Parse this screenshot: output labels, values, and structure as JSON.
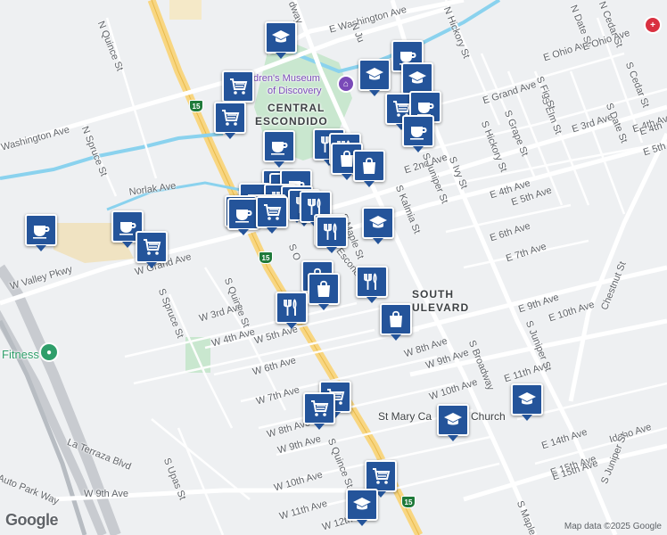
{
  "map": {
    "areas": [
      {
        "name": "central_escondido_1",
        "text": "CENTRAL"
      },
      {
        "name": "central_escondido_2",
        "text": "ESCONDIDO"
      },
      {
        "name": "south_boulevard_1",
        "text": "SOUTH"
      },
      {
        "name": "south_boulevard_2",
        "text": "ULEVARD"
      }
    ],
    "streets": [
      {
        "text": "E Washington Ave"
      },
      {
        "text": "N Quince St"
      },
      {
        "text": "N Spruce St"
      },
      {
        "text": "Washington Ave"
      },
      {
        "text": "Norlak Ave"
      },
      {
        "text": "W Valley Pkwy"
      },
      {
        "text": "W Grand Ave"
      },
      {
        "text": "S Spruce St"
      },
      {
        "text": "S Quince St"
      },
      {
        "text": "W 3rd Ave"
      },
      {
        "text": "W 4th Ave"
      },
      {
        "text": "W 5th Ave"
      },
      {
        "text": "W 6th Ave"
      },
      {
        "text": "W 7th Ave"
      },
      {
        "text": "W 8th Ave"
      },
      {
        "text": "W 9th Ave"
      },
      {
        "text": "W 10th Ave"
      },
      {
        "text": "W 11th Ave"
      },
      {
        "text": "W 12th"
      },
      {
        "text": "La Terraza Blvd"
      },
      {
        "text": "Auto Park Way"
      },
      {
        "text": "S Upas St"
      },
      {
        "text": "S Quince St"
      },
      {
        "text": "W 9th Ave"
      },
      {
        "text": "E 2nd Ave"
      },
      {
        "text": "E Grand Ave"
      },
      {
        "text": "E 3rd Ave"
      },
      {
        "text": "E 4th Ave"
      },
      {
        "text": "E 5th Ave"
      },
      {
        "text": "E 6th Ave"
      },
      {
        "text": "E 7th Ave"
      },
      {
        "text": "E 9th Ave"
      },
      {
        "text": "E 10th Ave"
      },
      {
        "text": "E 11th Ave"
      },
      {
        "text": "E 14th Ave"
      },
      {
        "text": "E 15th Ave"
      },
      {
        "text": "W 8th Ave"
      },
      {
        "text": "W 9th Ave"
      },
      {
        "text": "W 10th Ave"
      },
      {
        "text": "Idaho Ave"
      },
      {
        "text": "E Ohio Ave"
      },
      {
        "text": "S Juniper St"
      },
      {
        "text": "S Kalmia St"
      },
      {
        "text": "S Maple St"
      },
      {
        "text": "S Ivy St"
      },
      {
        "text": "S Hickory St"
      },
      {
        "text": "S Grape St"
      },
      {
        "text": "S Elm St"
      },
      {
        "text": "S Fig St"
      },
      {
        "text": "S Date St"
      },
      {
        "text": "S Cedar St"
      },
      {
        "text": "N Date St"
      },
      {
        "text": "N Cedar St"
      },
      {
        "text": "N Hickory St"
      },
      {
        "text": "Chestnut St"
      },
      {
        "text": "S Broadway"
      },
      {
        "text": "S Juniper St"
      },
      {
        "text": "E 4th Ave"
      },
      {
        "text": "E 5th Ave"
      },
      {
        "text": "S Maple"
      },
      {
        "text": "Escondido B"
      },
      {
        "text": "S O"
      },
      {
        "text": "E 15th Ave"
      },
      {
        "text": "E Ohio Ave"
      },
      {
        "text": "N Ju"
      },
      {
        "text": "dway"
      },
      {
        "text": "E 4th"
      },
      {
        "text": "S Juniper St"
      }
    ],
    "pois": [
      {
        "text": "dren's Museum"
      },
      {
        "text": "of Discovery"
      },
      {
        "text": "Fitness"
      },
      {
        "text": "St Mary Ca"
      },
      {
        "text": "Church"
      }
    ],
    "highway_shield": "15",
    "logo": "Google",
    "credit": "Map data ©2025 Google",
    "markers": [
      {
        "icon": "graduation-cap"
      },
      {
        "icon": "shopping-cart"
      },
      {
        "icon": "shopping-cart"
      },
      {
        "icon": "graduation-cap"
      },
      {
        "icon": "coffee-cup"
      },
      {
        "icon": "graduation-cap"
      },
      {
        "icon": "shopping-cart"
      },
      {
        "icon": "coffee-cup"
      },
      {
        "icon": "coffee-cup"
      },
      {
        "icon": "coffee-cup"
      },
      {
        "icon": "restaurant"
      },
      {
        "icon": "restaurant"
      },
      {
        "icon": "shopping-bag"
      },
      {
        "icon": "shopping-bag"
      },
      {
        "icon": "shopping-cart"
      },
      {
        "icon": "coffee-cup"
      },
      {
        "icon": "coffee-cup"
      },
      {
        "icon": "coffee-cup"
      },
      {
        "icon": "restaurant"
      },
      {
        "icon": "restaurant"
      },
      {
        "icon": "restaurant"
      },
      {
        "icon": "restaurant"
      },
      {
        "icon": "shopping-cart"
      },
      {
        "icon": "coffee-cup"
      },
      {
        "icon": "coffee-cup"
      },
      {
        "icon": "shopping-cart"
      },
      {
        "icon": "graduation-cap"
      },
      {
        "icon": "shopping-bag"
      },
      {
        "icon": "shopping-bag"
      },
      {
        "icon": "restaurant"
      },
      {
        "icon": "restaurant"
      },
      {
        "icon": "restaurant"
      },
      {
        "icon": "shopping-bag"
      },
      {
        "icon": "restaurant"
      },
      {
        "icon": "shopping-cart"
      },
      {
        "icon": "shopping-cart"
      },
      {
        "icon": "graduation-cap"
      },
      {
        "icon": "graduation-cap"
      },
      {
        "icon": "shopping-cart"
      },
      {
        "icon": "graduation-cap"
      },
      {
        "icon": "coffee-cup"
      }
    ],
    "colors": {
      "marker": "#24549a",
      "park": "#c9e7cf",
      "freeway": "#f8d681",
      "water": "#8ad2ee",
      "hospital": "#d93040",
      "museum": "#7a4ab8",
      "fitness": "#2f9e6a"
    }
  }
}
